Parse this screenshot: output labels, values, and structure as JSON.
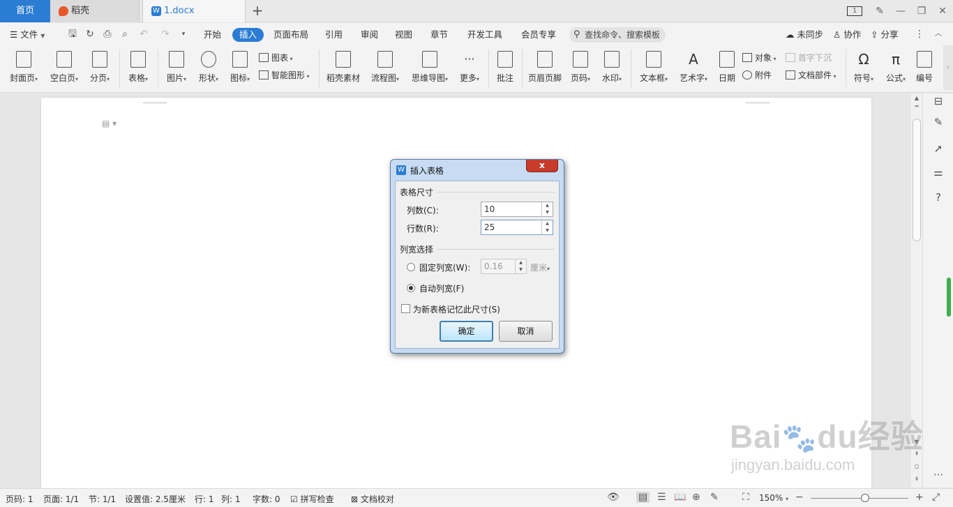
{
  "tabs": {
    "home": "首页",
    "daoke": "稻壳",
    "doc": "1.docx",
    "new_tab": "+",
    "doc_badge": "W"
  },
  "window": {
    "sync_badge": "1"
  },
  "menu": {
    "file": "文件",
    "items": [
      "开始",
      "插入",
      "页面布局",
      "引用",
      "审阅",
      "视图",
      "章节",
      "开发工具",
      "会员专享"
    ],
    "active": "插入",
    "search": "查找命令、搜索模板",
    "unsync": "未同步",
    "collab": "协作",
    "share": "分享"
  },
  "ribbon": {
    "cover": "封面页",
    "blank": "空白页",
    "pagebreak": "分页",
    "table": "表格",
    "picture": "图片",
    "shape": "形状",
    "iconlib": "图标",
    "chart": "图表",
    "smartart": "智能图形",
    "material": "稻壳素材",
    "flowchart": "流程图",
    "mindmap": "思维导图",
    "more": "更多",
    "comment": "批注",
    "header_footer": "页眉页脚",
    "page_number": "页码",
    "watermark": "水印",
    "textbox": "文本框",
    "wordart": "艺术字",
    "date": "日期",
    "object": "对象",
    "dropcap": "首字下沉",
    "attachment": "附件",
    "docpart": "文档部件",
    "symbol": "符号",
    "formula": "公式",
    "numbering": "编号"
  },
  "dialog": {
    "title": "插入表格",
    "title_icon": "W",
    "close": "x",
    "size_group": "表格尺寸",
    "cols_label": "列数(C):",
    "cols_value": "10",
    "rows_label": "行数(R):",
    "rows_value": "25",
    "width_group": "列宽选择",
    "fixed_label": "固定列宽(W):",
    "fixed_value": "0.16",
    "fixed_unit": "厘米",
    "auto_label": "自动列宽(F)",
    "auto_selected": true,
    "remember_label": "为新表格记忆此尺寸(S)",
    "remember_checked": false,
    "ok": "确定",
    "cancel": "取消"
  },
  "status": {
    "page_num": "页码: 1",
    "page": "页面: 1/1",
    "section": "节: 1/1",
    "setting": "设置值: 2.5厘米",
    "row": "行: 1",
    "col": "列: 1",
    "words": "字数: 0",
    "spell": "拼写检查",
    "proof": "文档校对",
    "zoom": "150%",
    "zoom_level_percent": 150
  },
  "watermark": {
    "brand": "Baidu经验",
    "url": "jingyan.baidu.com"
  },
  "colors": {
    "accent": "#2b7cd3",
    "close_red": "#c83a2a",
    "dialog_frame": "#c7dcf2"
  }
}
